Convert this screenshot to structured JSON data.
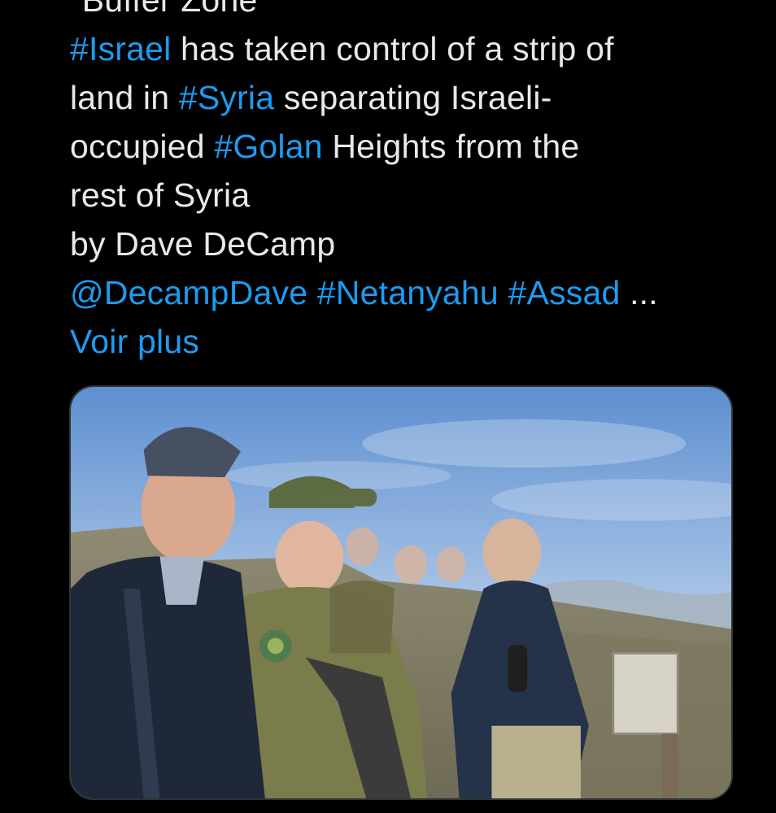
{
  "tweet": {
    "heading_partial": "\"Buffer Zone\"",
    "lines": [
      [
        {
          "type": "hashtag",
          "text": "#Israel"
        },
        {
          "type": "text",
          "text": " has taken control of a strip of"
        }
      ],
      [
        {
          "type": "text",
          "text": "land in "
        },
        {
          "type": "hashtag",
          "text": "#Syria"
        },
        {
          "type": "text",
          "text": " separating Israeli-"
        }
      ],
      [
        {
          "type": "text",
          "text": "occupied "
        },
        {
          "type": "hashtag",
          "text": "#Golan"
        },
        {
          "type": "text",
          "text": " Heights from the"
        }
      ],
      [
        {
          "type": "text",
          "text": "rest of Syria"
        }
      ],
      [
        {
          "type": "text",
          "text": "by Dave DeCamp"
        }
      ],
      [
        {
          "type": "mention",
          "text": "@DecampDave"
        },
        {
          "type": "text",
          "text": " "
        },
        {
          "type": "hashtag",
          "text": "#Netanyahu"
        },
        {
          "type": "text",
          "text": " "
        },
        {
          "type": "hashtag",
          "text": "#Assad"
        },
        {
          "type": "text",
          "text": " ..."
        }
      ]
    ],
    "see_more_label": "Voir plus"
  },
  "media": {
    "kind": "photo",
    "description_for_icon": "photo-of-officials-and-soldiers-on-hilltop"
  },
  "colors": {
    "background": "#000000",
    "text": "#e7e9ea",
    "link": "#1d9bf0",
    "card_border": "#2f3336"
  }
}
